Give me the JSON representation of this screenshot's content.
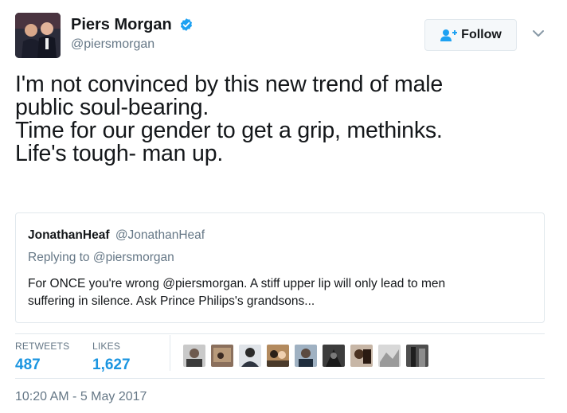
{
  "author": {
    "name": "Piers Morgan",
    "handle": "@piersmorgan",
    "verified": true,
    "avatar_icon": "profile-photo"
  },
  "follow_button": {
    "label": "Follow",
    "icon": "add-person-icon"
  },
  "menu_icon": "chevron-down-icon",
  "tweet": {
    "lines": [
      "I'm not convinced by this new trend of male",
      "public soul-bearing.",
      "Time for our gender to get a grip, methinks.",
      "Life's tough- man up."
    ]
  },
  "quoted_tweet": {
    "name": "JonathanHeaf",
    "handle": "@JonathanHeaf",
    "reply_context": "Replying to @piersmorgan",
    "text_lines": [
      "For ONCE you're wrong @piersmorgan. A stiff upper lip will only lead to men",
      "suffering in silence. Ask Prince Philips's grandsons..."
    ]
  },
  "stats": {
    "retweets": {
      "label": "RETWEETS",
      "value": "487"
    },
    "likes": {
      "label": "LIKES",
      "value": "1,627"
    }
  },
  "likers_count_shown": 9,
  "timestamp": "10:20 AM - 5 May 2017",
  "colors": {
    "link_blue": "#1b95e0",
    "secondary_gray": "#657786",
    "border": "#e1e8ed",
    "verified_blue": "#1da1f2"
  }
}
